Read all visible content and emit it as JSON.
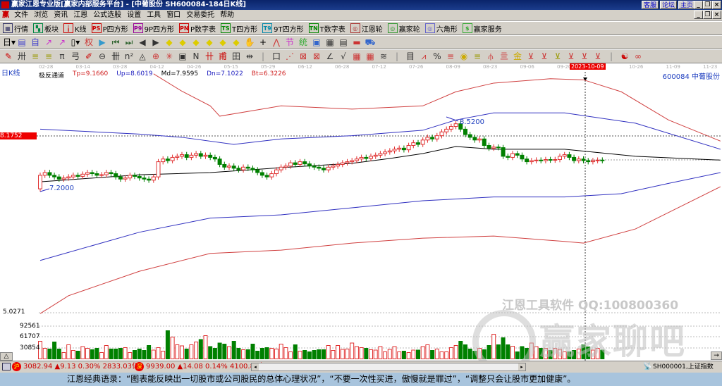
{
  "title": "赢家江恩专业版[赢家内部服务平台] - [中葡股份   SH600084-184日K线]",
  "title_buttons": [
    "客服",
    "论坛",
    "主页"
  ],
  "logo_text": "赢",
  "menu": [
    "文件",
    "浏览",
    "资讯",
    "江恩",
    "公式选股",
    "设置",
    "工具",
    "窗口",
    "交易委托",
    "帮助"
  ],
  "toolbar1": [
    {
      "icon": "market-icon",
      "glyph": "▦",
      "color": "#336",
      "label": "行情"
    },
    {
      "icon": "sector-icon",
      "glyph": "▚",
      "color": "#084",
      "label": "板块"
    },
    {
      "icon": "kline-icon",
      "glyph": "╽",
      "color": "#c00",
      "label": "K线"
    },
    {
      "icon": "p-square-icon",
      "glyph": "PS",
      "color": "#c00",
      "label": "P四方形"
    },
    {
      "icon": "9p-square-icon",
      "glyph": "P9",
      "color": "#909",
      "label": "9P四方形"
    },
    {
      "icon": "p-number-icon",
      "glyph": "PN",
      "color": "#c00",
      "label": "P数字表"
    },
    {
      "icon": "t-square-icon",
      "glyph": "TS",
      "color": "#080",
      "label": "T四方形"
    },
    {
      "icon": "9t-square-icon",
      "glyph": "T9",
      "color": "#08a",
      "label": "9T四方形"
    },
    {
      "icon": "t-number-icon",
      "glyph": "TN",
      "color": "#080",
      "label": "T数字表"
    },
    {
      "icon": "gann-wheel-icon",
      "glyph": "◎",
      "color": "#a33",
      "label": "江恩轮"
    },
    {
      "icon": "winner-wheel-icon",
      "glyph": "◎",
      "color": "#393",
      "label": "赢家轮"
    },
    {
      "icon": "hexagon-icon",
      "glyph": "◎",
      "color": "#66c",
      "label": "六角形"
    },
    {
      "icon": "service-icon",
      "glyph": "$",
      "color": "#3a3",
      "label": "赢家服务"
    }
  ],
  "toolbar2": [
    {
      "icon": "period-select-icon",
      "glyph": "日▾",
      "color": "#000"
    },
    {
      "icon": "chart-mode-icon",
      "glyph": "▤",
      "color": "#44c"
    },
    {
      "icon": "self-select-icon",
      "glyph": "自",
      "color": "#44c"
    },
    {
      "icon": "indicator-icon",
      "glyph": "↗",
      "color": "#c3c"
    },
    {
      "icon": "indicator2-icon",
      "glyph": "↗",
      "color": "#c3c"
    },
    {
      "icon": "candle-select-icon",
      "glyph": "▯▾",
      "color": "#000"
    },
    {
      "icon": "rights-icon",
      "glyph": "权",
      "color": "#c33"
    },
    {
      "icon": "flag-icon",
      "glyph": "▶",
      "color": "#39c"
    },
    {
      "icon": "first-icon",
      "glyph": "⏮",
      "color": "#363"
    },
    {
      "icon": "last-icon",
      "glyph": "⏭",
      "color": "#363"
    },
    {
      "icon": "left-icon",
      "glyph": "◀",
      "color": "#333"
    },
    {
      "icon": "right-icon",
      "glyph": "▶",
      "color": "#333"
    },
    {
      "icon": "zoom-in-icon",
      "glyph": "◆",
      "color": "#dc0"
    },
    {
      "icon": "zoom-out-icon",
      "glyph": "◆",
      "color": "#dc0"
    },
    {
      "icon": "expand-icon",
      "glyph": "◆",
      "color": "#dc0"
    },
    {
      "icon": "shrink-icon",
      "glyph": "◆",
      "color": "#dc0"
    },
    {
      "icon": "up-icon",
      "glyph": "◆",
      "color": "#dc0"
    },
    {
      "icon": "down-icon",
      "glyph": "◆",
      "color": "#dc0"
    },
    {
      "icon": "hand-icon",
      "glyph": "✋",
      "color": "#333"
    },
    {
      "icon": "crosshair-icon",
      "glyph": "+",
      "color": "#000"
    },
    {
      "icon": "trend-icon",
      "glyph": "⋀",
      "color": "#c33"
    },
    {
      "icon": "festival-icon",
      "glyph": "节",
      "color": "#c3c"
    },
    {
      "icon": "stats-icon",
      "glyph": "统",
      "color": "#3a3"
    },
    {
      "icon": "calendar-icon",
      "glyph": "▣",
      "color": "#36c"
    },
    {
      "icon": "calculator-icon",
      "glyph": "▦",
      "color": "#333"
    },
    {
      "icon": "notes-icon",
      "glyph": "▤",
      "color": "#333"
    },
    {
      "icon": "save-icon",
      "glyph": "▬",
      "color": "#c33"
    },
    {
      "icon": "trade-icon",
      "glyph": "⛟",
      "color": "#36c"
    }
  ],
  "toolbar3": [
    {
      "icon": "pen-icon",
      "glyph": "✎",
      "color": "#c00"
    },
    {
      "icon": "grid-icon",
      "glyph": "卅",
      "color": "#333"
    },
    {
      "icon": "gold-line-icon",
      "glyph": "≡",
      "color": "#990"
    },
    {
      "icon": "gold-line2-icon",
      "glyph": "≡",
      "color": "#990"
    },
    {
      "icon": "line-tool-icon",
      "glyph": "π",
      "color": "#333"
    },
    {
      "icon": "wave-icon",
      "glyph": "弓",
      "color": "#333"
    },
    {
      "icon": "brush-icon",
      "glyph": "✐",
      "color": "#c00"
    },
    {
      "icon": "circle-icon",
      "glyph": "⊖",
      "color": "#333"
    },
    {
      "icon": "cycle-icon",
      "glyph": "卌",
      "color": "#333"
    },
    {
      "icon": "n2-icon",
      "glyph": "n²",
      "color": "#333"
    },
    {
      "icon": "triangle-icon",
      "glyph": "◬",
      "color": "#333"
    },
    {
      "icon": "fan-icon",
      "glyph": "⊕",
      "color": "#c33"
    },
    {
      "icon": "star-icon",
      "glyph": "✳",
      "color": "#c33"
    },
    {
      "icon": "box-icon",
      "glyph": "▣",
      "color": "#333"
    },
    {
      "icon": "n-icon",
      "glyph": "N",
      "color": "#333"
    },
    {
      "icon": "mark-icon",
      "glyph": "卄",
      "color": "#c00"
    },
    {
      "icon": "mark2-icon",
      "glyph": "甫",
      "color": "#c00"
    },
    {
      "icon": "table-icon",
      "glyph": "田",
      "color": "#333"
    },
    {
      "icon": "range-icon",
      "glyph": "⇹",
      "color": "#333"
    },
    {
      "icon": "sep1-icon",
      "glyph": "|",
      "color": "#888"
    },
    {
      "icon": "rect-icon",
      "glyph": "口",
      "color": "#333"
    },
    {
      "icon": "speed-icon",
      "glyph": "⋰",
      "color": "#c33"
    },
    {
      "icon": "gann-box-icon",
      "glyph": "⊠",
      "color": "#c33"
    },
    {
      "icon": "gann-box2-icon",
      "glyph": "⊠",
      "color": "#c33"
    },
    {
      "icon": "angle-icon",
      "glyph": "∠",
      "color": "#333"
    },
    {
      "icon": "vee-icon",
      "glyph": "√",
      "color": "#333"
    },
    {
      "icon": "matrix-icon",
      "glyph": "▦",
      "color": "#c33"
    },
    {
      "icon": "matrix2-icon",
      "glyph": "▦",
      "color": "#c33"
    },
    {
      "icon": "lines-icon",
      "glyph": "≋",
      "color": "#333"
    },
    {
      "icon": "sep2-icon",
      "glyph": "|",
      "color": "#888"
    },
    {
      "icon": "bar-icon",
      "glyph": "目",
      "color": "#333"
    },
    {
      "icon": "trend-kill-icon",
      "glyph": "⩘",
      "color": "#c33"
    },
    {
      "icon": "percent-icon",
      "glyph": "%",
      "color": "#333"
    },
    {
      "icon": "pct-line-icon",
      "glyph": "≡",
      "color": "#c33"
    },
    {
      "icon": "gold-coin-icon",
      "glyph": "◉",
      "color": "#ca0"
    },
    {
      "icon": "gold-line3-icon",
      "glyph": "≡",
      "color": "#990"
    },
    {
      "icon": "fork-icon",
      "glyph": "⫛",
      "color": "#c33"
    },
    {
      "icon": "level-icon",
      "glyph": "亖",
      "color": "#c33"
    },
    {
      "icon": "gold-level-icon",
      "glyph": "金",
      "color": "#ca0"
    },
    {
      "icon": "angle2-icon",
      "glyph": "⊻",
      "color": "#c33"
    },
    {
      "icon": "fan2-icon",
      "glyph": "⊻",
      "color": "#c33"
    },
    {
      "icon": "fan3-icon",
      "glyph": "⊻",
      "color": "#990"
    },
    {
      "icon": "fan4-icon",
      "glyph": "⊻",
      "color": "#c33"
    },
    {
      "icon": "fan5-icon",
      "glyph": "⊻",
      "color": "#c33"
    },
    {
      "icon": "fan6-icon",
      "glyph": "⊻",
      "color": "#c33"
    },
    {
      "icon": "sep3-icon",
      "glyph": "|",
      "color": "#888"
    },
    {
      "icon": "yinyang-icon",
      "glyph": "☯",
      "color": "#c00"
    },
    {
      "icon": "infinity-icon",
      "glyph": "∞",
      "color": "#c33"
    }
  ],
  "period_label": "日K线",
  "dates": [
    "02-28",
    "03-14",
    "03-28",
    "04-12",
    "04-26",
    "05-15",
    "05-29",
    "06-12",
    "06-28",
    "07-12",
    "07-26",
    "08-09",
    "08-23",
    "09-06",
    "09-20",
    "2023-10-09",
    "10-26",
    "11-09",
    "11-23"
  ],
  "indicator": {
    "name": "极反通道",
    "tp": "Tp=9.1660",
    "up": "Up=8.6019",
    "md": "Md=7.9595",
    "dn": "Dn=7.1022",
    "bt": "Bt=6.3226"
  },
  "stock": "600084  中葡股份",
  "cursor_price": "8.1752",
  "annotations": {
    "high": "8.5200",
    "low": "7.2000"
  },
  "vol_axis": [
    "5.0271",
    "92561",
    "61707",
    "30854"
  ],
  "watermark": {
    "line1": "江恩工具软件  QQ:100800360",
    "line2": "赢家聊吧"
  },
  "colors": {
    "up": "#e03030",
    "down": "#008000",
    "upper_band": "#d04040",
    "mid_band": "#4040c0",
    "middle": "#000000"
  },
  "chart_data": {
    "type": "candlestick",
    "closes": [
      7.45,
      7.5,
      7.45,
      7.42,
      7.38,
      7.4,
      7.42,
      7.45,
      7.43,
      7.47,
      7.5,
      7.48,
      7.45,
      7.46,
      7.5,
      7.48,
      7.42,
      7.38,
      7.4,
      7.45,
      7.43,
      7.4,
      7.38,
      7.36,
      7.42,
      7.7,
      7.75,
      7.72,
      7.78,
      7.8,
      7.83,
      7.78,
      7.82,
      7.85,
      7.8,
      7.82,
      7.78,
      7.75,
      7.65,
      7.6,
      7.62,
      7.58,
      7.55,
      7.6,
      7.58,
      7.55,
      7.5,
      7.45,
      7.42,
      7.48,
      7.55,
      7.6,
      7.62,
      7.68,
      7.65,
      7.7,
      7.66,
      7.62,
      7.6,
      7.58,
      7.55,
      7.6,
      7.62,
      7.65,
      7.68,
      7.7,
      7.72,
      7.75,
      7.78,
      7.76,
      7.8,
      7.82,
      7.85,
      7.88,
      7.9,
      7.93,
      7.95,
      7.92,
      8.0,
      8.05,
      8.02,
      8.1,
      8.15,
      8.12,
      8.18,
      8.25,
      8.3,
      8.35,
      8.4,
      8.3,
      8.2,
      8.15,
      8.1,
      8.12,
      8.0,
      7.95,
      7.97,
      7.96,
      7.8,
      7.78,
      7.85,
      7.82,
      7.75,
      7.7,
      7.72,
      7.73,
      7.72,
      7.74,
      7.73,
      7.74,
      7.8,
      7.83,
      7.78,
      7.72,
      7.75,
      7.72,
      7.7,
      7.72,
      7.73,
      7.72
    ],
    "volumes": [
      50,
      30,
      28,
      48,
      28,
      18,
      40,
      24,
      22,
      35,
      30,
      26,
      30,
      18,
      38,
      28,
      28,
      30,
      32,
      18,
      24,
      28,
      24,
      38,
      25,
      32,
      22,
      80,
      62,
      40,
      37,
      28,
      40,
      48,
      55,
      66,
      35,
      30,
      45,
      42,
      35,
      50,
      30,
      26,
      26,
      42,
      22,
      30,
      32,
      30,
      28,
      42,
      32,
      20,
      40,
      22,
      24,
      20,
      24,
      26,
      26,
      38,
      24,
      38,
      27,
      28,
      45,
      35,
      32,
      30,
      26,
      25,
      35,
      20,
      27,
      35,
      20,
      22,
      18,
      25,
      25,
      35,
      40,
      24,
      28,
      20,
      20,
      32,
      38,
      50,
      40,
      28,
      22,
      30,
      26,
      38,
      70,
      40,
      60,
      40,
      36,
      20,
      35,
      30,
      45,
      35,
      30,
      30,
      24,
      30,
      27,
      20,
      20,
      24,
      28,
      40,
      34,
      25,
      30,
      25,
      20,
      20,
      35,
      32,
      25,
      22,
      20,
      20,
      25,
      25
    ],
    "bands": {
      "tp": [
        [
          24,
          9.32
        ],
        [
          30,
          9.0
        ],
        [
          36,
          8.73
        ],
        [
          38,
          8.54
        ],
        [
          51,
          8.73
        ],
        [
          66,
          8.67
        ],
        [
          81,
          8.73
        ],
        [
          88,
          8.99
        ],
        [
          96,
          9.15
        ],
        [
          108,
          9.23
        ],
        [
          115,
          9.21
        ],
        [
          123,
          8.99
        ],
        [
          133,
          8.47
        ],
        [
          144,
          8.08
        ]
      ],
      "up": [
        [
          0,
          8.3
        ],
        [
          21,
          8.21
        ],
        [
          30,
          8.15
        ],
        [
          41,
          8.02
        ],
        [
          51,
          8.12
        ],
        [
          66,
          8.18
        ],
        [
          81,
          8.28
        ],
        [
          88,
          8.47
        ],
        [
          96,
          8.6
        ],
        [
          111,
          8.6
        ],
        [
          126,
          8.41
        ],
        [
          144,
          7.93
        ]
      ],
      "md": [
        [
          0,
          7.33
        ],
        [
          21,
          7.46
        ],
        [
          36,
          7.5
        ],
        [
          51,
          7.59
        ],
        [
          66,
          7.67
        ],
        [
          74,
          7.76
        ],
        [
          81,
          7.85
        ],
        [
          88,
          7.98
        ],
        [
          96,
          7.93
        ],
        [
          111,
          7.93
        ],
        [
          126,
          7.8
        ],
        [
          144,
          7.73
        ]
      ],
      "dn": [
        [
          0,
          5.88
        ],
        [
          21,
          6.4
        ],
        [
          36,
          6.66
        ],
        [
          51,
          6.72
        ],
        [
          66,
          6.85
        ],
        [
          81,
          6.98
        ],
        [
          96,
          7.05
        ],
        [
          111,
          7.05
        ],
        [
          123,
          7.11
        ],
        [
          133,
          7.3
        ],
        [
          144,
          7.5
        ]
      ],
      "bt": [
        [
          0,
          4.9
        ],
        [
          6,
          5.23
        ],
        [
          21,
          5.68
        ],
        [
          36,
          6.01
        ],
        [
          51,
          6.07
        ],
        [
          66,
          6.2
        ],
        [
          81,
          6.29
        ],
        [
          96,
          6.33
        ],
        [
          111,
          6.23
        ],
        [
          115,
          6.2
        ],
        [
          126,
          6.46
        ],
        [
          144,
          7.24
        ]
      ]
    }
  },
  "status": {
    "sh": "3082.94 ▲9.13 0.30% 2833.03亿",
    "sz": "9939.00 ▲14.08 0.14% 4100.80亿",
    "sh_badge": "沪",
    "sz_badge": "深",
    "index": "SH000001,上证指数",
    "toggle": "△"
  },
  "quote": "江恩经典语录：“图表能反映出一切股市或公司股民的总体心理状况”，“不要一次性买进，傲慢就是罪过”，“调整只会让股市更加健康”。"
}
